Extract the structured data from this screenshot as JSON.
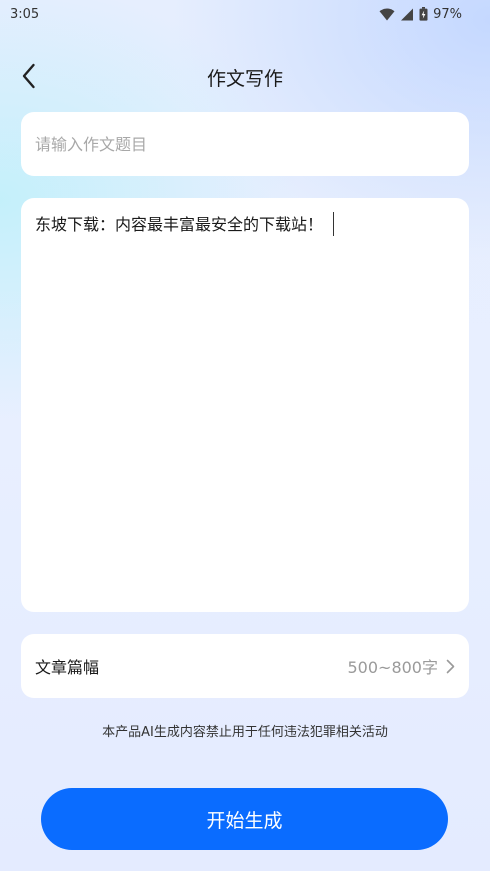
{
  "status_bar": {
    "time": "3:05",
    "battery": "97%",
    "icons": [
      "wifi-icon",
      "cellular-signal-icon",
      "battery-icon"
    ]
  },
  "header": {
    "back_icon": "chevron-left-icon",
    "title": "作文写作"
  },
  "form": {
    "title_input": {
      "value": "",
      "placeholder": "请输入作文题目"
    },
    "content": {
      "value": "东坡下载：内容最丰富最安全的下载站！"
    },
    "length": {
      "label": "文章篇幅",
      "value": "500~800字",
      "icon": "chevron-right-icon"
    }
  },
  "disclaimer": "本产品AI生成内容禁止用于任何违法犯罪相关活动",
  "generate_button": {
    "label": "开始生成"
  },
  "colors": {
    "primary": "#0a6cff",
    "card_background": "#ffffff",
    "placeholder": "#a8a8a8",
    "secondary_text": "#9a9a9a"
  }
}
